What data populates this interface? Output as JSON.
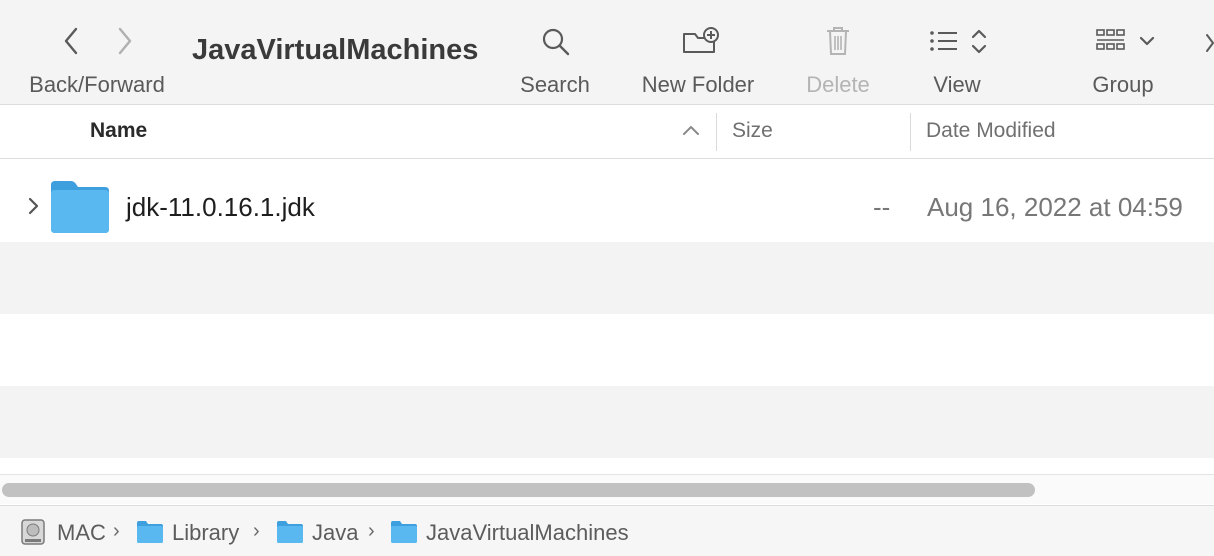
{
  "toolbar": {
    "back_forward_label": "Back/Forward",
    "title": "JavaVirtualMachines",
    "search_label": "Search",
    "new_folder_label": "New Folder",
    "delete_label": "Delete",
    "view_label": "View",
    "group_label": "Group"
  },
  "columns": {
    "name": "Name",
    "size": "Size",
    "date_modified": "Date Modified"
  },
  "files": [
    {
      "name": "jdk-11.0.16.1.jdk",
      "size": "--",
      "date_modified": "Aug 16, 2022 at 04:59",
      "icon": "folder-icon"
    }
  ],
  "path": [
    {
      "label": "MAC",
      "icon": "hard-drive-icon"
    },
    {
      "label": "Library",
      "icon": "folder-icon"
    },
    {
      "label": "Java",
      "icon": "folder-icon"
    },
    {
      "label": "JavaVirtualMachines",
      "icon": "folder-icon"
    }
  ],
  "colors": {
    "folder_blue": "#5ab8f0",
    "toolbar_bg": "#f4f4f4",
    "stripe": "#f3f3f3"
  }
}
